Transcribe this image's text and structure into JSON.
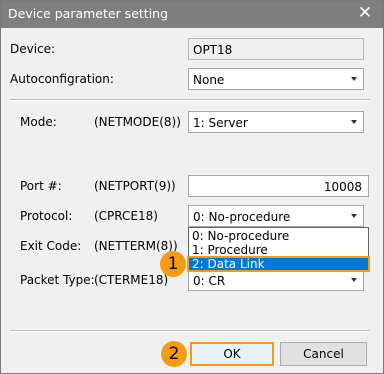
{
  "window": {
    "title": "Device parameter setting",
    "close_icon": "close-icon"
  },
  "device": {
    "label": "Device:",
    "value": "OPT18"
  },
  "autoconfig": {
    "label": "Autoconfigration:",
    "value": "None"
  },
  "mode": {
    "label": "Mode:",
    "param": "(NETMODE(8))",
    "value": "1: Server"
  },
  "port": {
    "label": "Port #:",
    "param": "(NETPORT(9))",
    "value": "10008"
  },
  "protocol": {
    "label": "Protocol:",
    "param": "(CPRCE18)",
    "value": "0: No-procedure",
    "options": [
      "0: No-procedure",
      "1: Procedure",
      "2: Data Link"
    ],
    "selected_index": 2
  },
  "exit_code": {
    "label": "Exit Code:",
    "param": "(NETTERM(8))"
  },
  "packet_type": {
    "label": "Packet Type:",
    "param": "(CTERME18)",
    "value": "0: CR"
  },
  "callouts": {
    "one": "1",
    "two": "2"
  },
  "buttons": {
    "ok": "OK",
    "cancel": "Cancel"
  },
  "colors": {
    "titlebar": "#7f7f7f",
    "callout": "#f39c12",
    "selection": "#0078d7"
  }
}
